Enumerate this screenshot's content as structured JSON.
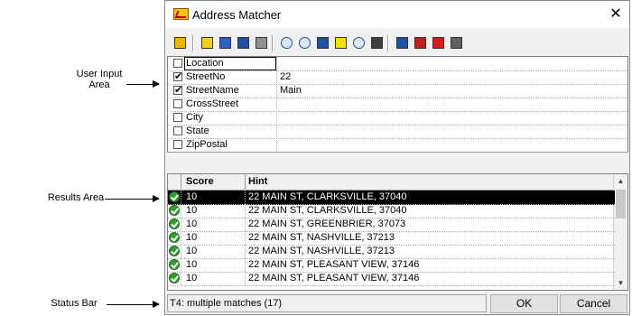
{
  "annotations": {
    "user_input_line1": "User Input",
    "user_input_line2": "Area",
    "results": "Results Area",
    "status": "Status Bar"
  },
  "window": {
    "title": "Address Matcher",
    "close_glyph": "✕"
  },
  "toolbar": {
    "buttons": [
      {
        "icon": "exit-door-icon",
        "color": "#f0b400"
      },
      {
        "icon": "envelope-icon",
        "color": "#f5d020"
      },
      {
        "icon": "edit-document-icon",
        "color": "#3060c0"
      },
      {
        "icon": "copy-icon",
        "color": "#2050a0"
      },
      {
        "icon": "truck-icon",
        "color": "#909090"
      },
      {
        "icon": "zoom-in-icon",
        "color": "#2050a0"
      },
      {
        "icon": "zoom-out-icon",
        "color": "#2050a0"
      },
      {
        "icon": "magic-wand-icon",
        "color": "#2050a0"
      },
      {
        "icon": "highlight-star-icon",
        "color": "#f5e000"
      },
      {
        "icon": "find-icon",
        "color": "#2050a0"
      },
      {
        "icon": "sort-icon",
        "color": "#404040"
      },
      {
        "icon": "properties-icon",
        "color": "#2050a0"
      },
      {
        "icon": "close-window-icon",
        "color": "#c02020"
      },
      {
        "icon": "pdf-export-icon",
        "color": "#d02020"
      },
      {
        "icon": "settings-icon",
        "color": "#606060"
      }
    ]
  },
  "inputs": {
    "rows": [
      {
        "label": "Location",
        "value": "",
        "checked": false
      },
      {
        "label": "StreetNo",
        "value": "22",
        "checked": true
      },
      {
        "label": "StreetName",
        "value": "Main",
        "checked": true
      },
      {
        "label": "CrossStreet",
        "value": "",
        "checked": false
      },
      {
        "label": "City",
        "value": "",
        "checked": false
      },
      {
        "label": "State",
        "value": "",
        "checked": false
      },
      {
        "label": "ZipPostal",
        "value": "",
        "checked": false
      }
    ]
  },
  "results": {
    "headers": {
      "score": "Score",
      "hint": "Hint"
    },
    "rows": [
      {
        "score": "10",
        "hint": "22 MAIN ST, CLARKSVILLE, 37040",
        "selected": true
      },
      {
        "score": "10",
        "hint": "22 MAIN ST, CLARKSVILLE, 37040",
        "selected": false
      },
      {
        "score": "10",
        "hint": "22 MAIN ST, GREENBRIER, 37073",
        "selected": false
      },
      {
        "score": "10",
        "hint": "22 MAIN ST, NASHVILLE, 37213",
        "selected": false
      },
      {
        "score": "10",
        "hint": "22 MAIN ST, NASHVILLE, 37213",
        "selected": false
      },
      {
        "score": "10",
        "hint": "22 MAIN ST, PLEASANT VIEW, 37146",
        "selected": false
      },
      {
        "score": "10",
        "hint": "22 MAIN ST, PLEASANT VIEW, 37146",
        "selected": false
      }
    ]
  },
  "status": {
    "text": "T4: multiple matches (17)"
  },
  "buttons": {
    "ok": "OK",
    "cancel": "Cancel"
  }
}
